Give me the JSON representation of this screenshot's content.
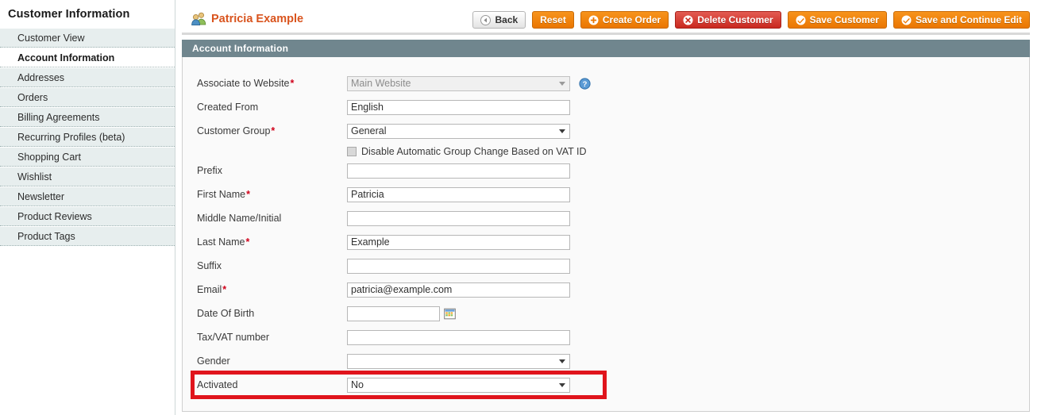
{
  "sidebar": {
    "title": "Customer Information",
    "items": [
      {
        "label": "Customer View",
        "active": false
      },
      {
        "label": "Account Information",
        "active": true
      },
      {
        "label": "Addresses",
        "active": false
      },
      {
        "label": "Orders",
        "active": false
      },
      {
        "label": "Billing Agreements",
        "active": false
      },
      {
        "label": "Recurring Profiles (beta)",
        "active": false
      },
      {
        "label": "Shopping Cart",
        "active": false
      },
      {
        "label": "Wishlist",
        "active": false
      },
      {
        "label": "Newsletter",
        "active": false
      },
      {
        "label": "Product Reviews",
        "active": false
      },
      {
        "label": "Product Tags",
        "active": false
      }
    ]
  },
  "header": {
    "title": "Patricia Example",
    "title_icon": "customers-icon",
    "title_color": "#d9541e",
    "buttons": [
      {
        "label": "Back",
        "style": "grey",
        "icon": "back-arrow-icon"
      },
      {
        "label": "Reset",
        "style": "orange",
        "icon": ""
      },
      {
        "label": "Create Order",
        "style": "orange",
        "icon": "plus-circle-icon"
      },
      {
        "label": "Delete Customer",
        "style": "red",
        "icon": "x-circle-icon"
      },
      {
        "label": "Save Customer",
        "style": "orange",
        "icon": "check-circle-icon"
      },
      {
        "label": "Save and Continue Edit",
        "style": "orange",
        "icon": "check-circle-icon"
      }
    ]
  },
  "panel": {
    "heading": "Account Information",
    "fields": [
      {
        "label": "Associate to Website",
        "required": true,
        "type": "select",
        "value": "Main Website",
        "disabled": true,
        "help_icon": "help-circle-icon"
      },
      {
        "label": "Created From",
        "required": false,
        "type": "text",
        "value": "English",
        "placeholder": ""
      },
      {
        "label": "Customer Group",
        "required": true,
        "type": "select",
        "value": "General",
        "disabled": false,
        "checkbox": {
          "label": "Disable Automatic Group Change Based on VAT ID",
          "checked": false
        }
      },
      {
        "label": "Prefix",
        "required": false,
        "type": "text",
        "value": "",
        "placeholder": ""
      },
      {
        "label": "First Name",
        "required": true,
        "type": "text",
        "value": "Patricia",
        "placeholder": ""
      },
      {
        "label": "Middle Name/Initial",
        "required": false,
        "type": "text",
        "value": "",
        "placeholder": ""
      },
      {
        "label": "Last Name",
        "required": true,
        "type": "text",
        "value": "Example",
        "placeholder": ""
      },
      {
        "label": "Suffix",
        "required": false,
        "type": "text",
        "value": "",
        "placeholder": ""
      },
      {
        "label": "Email",
        "required": true,
        "type": "text",
        "value": "patricia@example.com",
        "placeholder": ""
      },
      {
        "label": "Date Of Birth",
        "required": false,
        "type": "text-short",
        "value": "",
        "placeholder": "",
        "calendar_icon": "calendar-icon"
      },
      {
        "label": "Tax/VAT number",
        "required": false,
        "type": "text",
        "value": "",
        "placeholder": ""
      },
      {
        "label": "Gender",
        "required": false,
        "type": "select",
        "value": "",
        "disabled": false
      },
      {
        "label": "Activated",
        "required": false,
        "type": "select",
        "value": "No",
        "disabled": false,
        "highlighted": true
      }
    ]
  },
  "annotation": {
    "target": "Activated",
    "color": "#e0141c"
  }
}
